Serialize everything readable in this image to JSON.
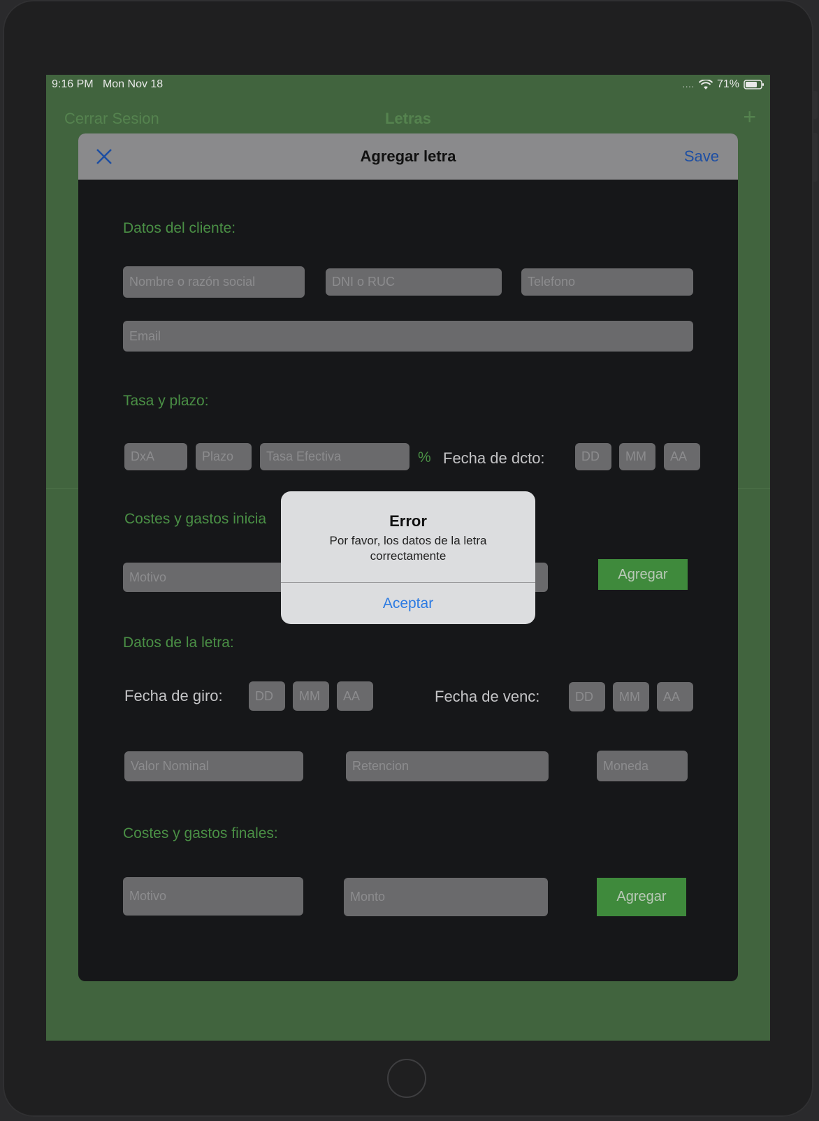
{
  "status_bar": {
    "time": "9:16 PM",
    "date": "Mon Nov 18",
    "battery": "71%",
    "dots": "...."
  },
  "navbar": {
    "left_label": "Cerrar Sesion",
    "title": "Letras",
    "add_icon": "+"
  },
  "modal": {
    "title": "Agregar letra",
    "save_label": "Save",
    "close_icon": "close-icon",
    "cliente": {
      "section": "Datos del  cliente:",
      "nombre_placeholder": "Nombre o razón social",
      "dni_placeholder": "DNI o RUC",
      "telefono_placeholder": "Telefono",
      "email_placeholder": "Email"
    },
    "tasa": {
      "section": "Tasa y plazo:",
      "dxa_placeholder": "DxA",
      "plazo_placeholder": "Plazo",
      "tasa_placeholder": "Tasa Efectiva",
      "percent": "%",
      "fecha_label": "Fecha de dcto:",
      "dd": "DD",
      "mm": "MM",
      "aa": "AA"
    },
    "costes_iniciales": {
      "section": "Costes y gastos inicia",
      "motivo_placeholder": "Motivo",
      "agregar_label": "Agregar"
    },
    "letra": {
      "section": "Datos de la letra:",
      "giro_label": "Fecha de giro:",
      "venc_label": "Fecha de venc:",
      "dd": "DD",
      "mm": "MM",
      "aa": "AA",
      "valor_placeholder": "Valor Nominal",
      "retencion_placeholder": "Retencion",
      "moneda_placeholder": "Moneda"
    },
    "costes_finales": {
      "section": "Costes y gastos finales:",
      "motivo_placeholder": "Motivo",
      "monto_placeholder": "Monto",
      "agregar_label": "Agregar"
    }
  },
  "alert": {
    "title": "Error",
    "message": "Por favor, los datos de la letra correctamente",
    "button": "Aceptar"
  },
  "colors": {
    "background_green": "#41643e",
    "accent_green": "#4a8f45",
    "link_blue": "#2b7ae2",
    "save_blue": "#1e4fa3"
  }
}
